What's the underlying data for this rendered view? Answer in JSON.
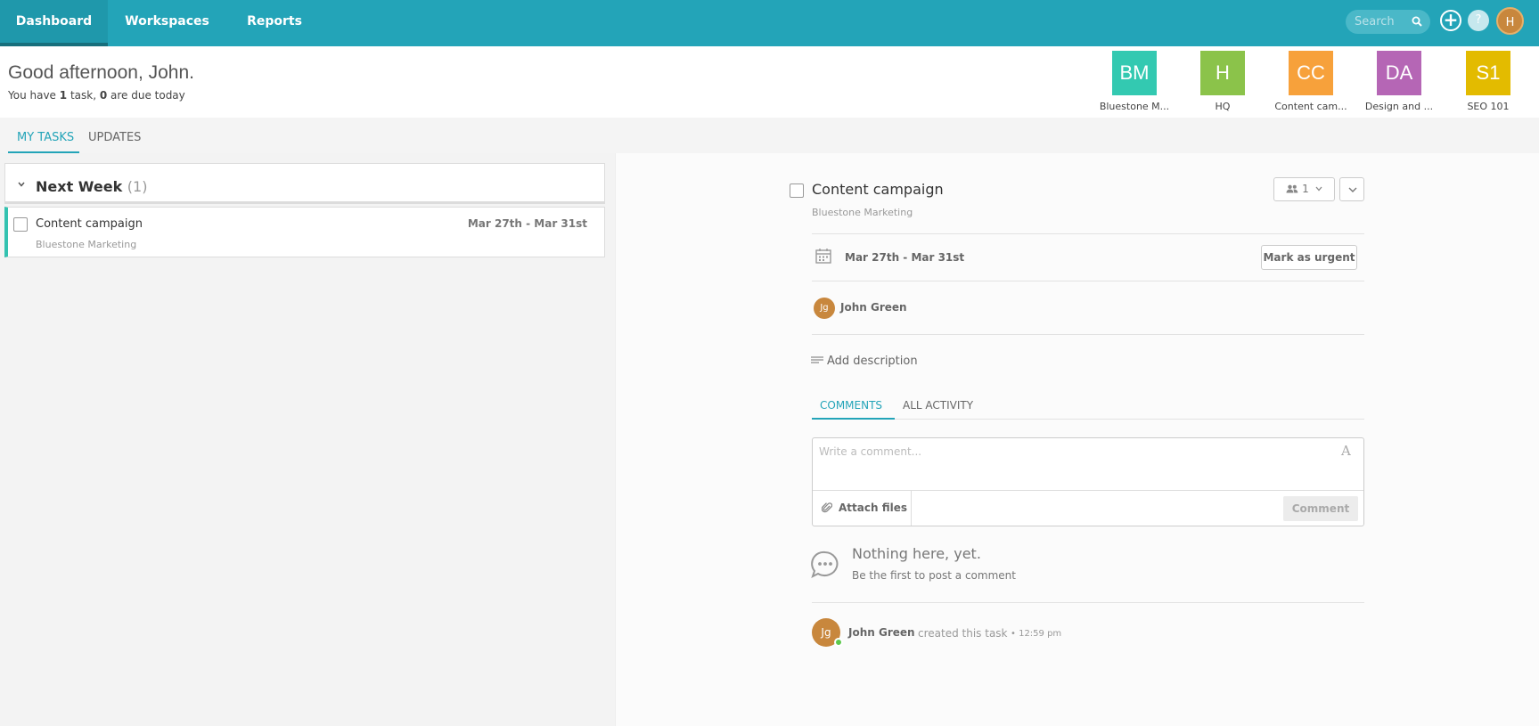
{
  "topbar": {
    "nav": [
      "Dashboard",
      "Workspaces",
      "Reports"
    ],
    "search_placeholder": "Search",
    "help_label": "?",
    "user_initial": "H"
  },
  "header": {
    "greeting": "Good afternoon, John.",
    "sub_prefix": "You have ",
    "task_count": "1",
    "sub_mid": " task,  ",
    "due_count": "0",
    "sub_suffix": " are due today"
  },
  "workspaces": [
    {
      "initials": "BM",
      "name": "Bluestone M...",
      "color": "#33c9b1"
    },
    {
      "initials": "H",
      "name": "HQ",
      "color": "#8bc34a"
    },
    {
      "initials": "CC",
      "name": "Content cam...",
      "color": "#f7a13b"
    },
    {
      "initials": "DA",
      "name": "Design and ...",
      "color": "#b566b5"
    },
    {
      "initials": "S1",
      "name": "SEO 101",
      "color": "#e3bb00"
    }
  ],
  "tabs": [
    "MY TASKS",
    "UPDATES"
  ],
  "task_group": {
    "title": "Next Week",
    "count": "(1)"
  },
  "task": {
    "name": "Content campaign",
    "workspace": "Bluestone Marketing",
    "dates": "Mar 27th - Mar 31st"
  },
  "detail": {
    "title": "Content campaign",
    "workspace": "Bluestone Marketing",
    "assign_count": "1",
    "dates": "Mar 27th - Mar 31st",
    "urgent_label": "Mark as urgent",
    "assignee_initials": "Jg",
    "assignee": "John Green",
    "add_description": "Add description",
    "comment_tabs": [
      "COMMENTS",
      "ALL ACTIVITY"
    ],
    "comment_placeholder": "Write a comment...",
    "font_label": "A",
    "attach_label": "Attach files",
    "comment_button": "Comment",
    "empty_title": "Nothing here, yet.",
    "empty_sub": "Be the first to post a comment",
    "activity": {
      "initials": "Jg",
      "user": "John Green",
      "text": "created this task",
      "time": "• 12:59 pm"
    }
  }
}
